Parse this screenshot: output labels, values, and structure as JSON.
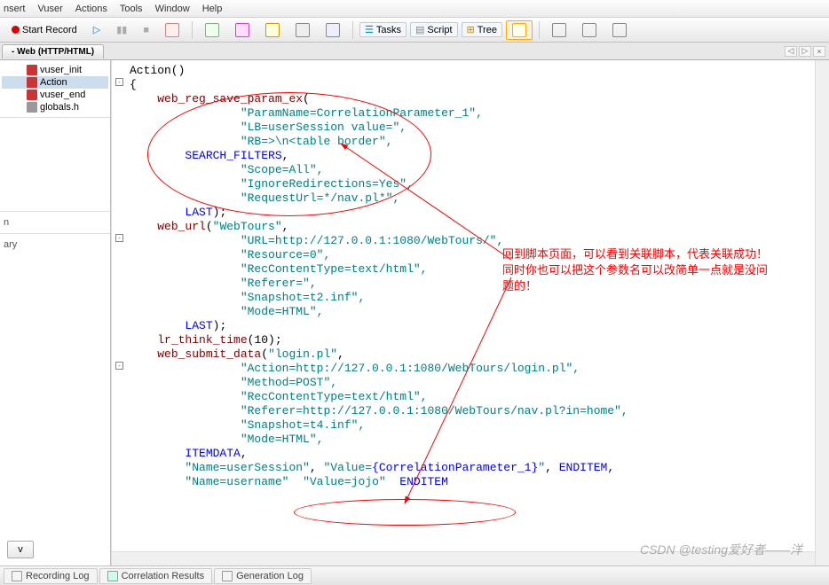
{
  "menu": {
    "insert": "nsert",
    "vuser": "Vuser",
    "actions": "Actions",
    "tools": "Tools",
    "window": "Window",
    "help": "Help"
  },
  "toolbar": {
    "startRecord": "Start Record",
    "tasks": "Tasks",
    "script": "Script",
    "tree": "Tree"
  },
  "scriptTab": {
    "title": "- Web (HTTP/HTML)"
  },
  "tree": {
    "vuser_init": "vuser_init",
    "action": "Action",
    "vuser_end": "vuser_end",
    "globals": "globals.h"
  },
  "side": {
    "n": "n",
    "ary": "ary",
    "btn": "v"
  },
  "code": {
    "l1": "Action()",
    "l2": "{",
    "l3": "    web_reg_save_param_ex(",
    "l4": "        \"ParamName=CorrelationParameter_1\",",
    "l5": "        \"LB=userSession value=\",",
    "l6": "        \"RB=>\\n<table border\",",
    "l7": "        SEARCH_FILTERS,",
    "l8": "        \"Scope=All\",",
    "l9": "        \"IgnoreRedirections=Yes\",",
    "l10": "        \"RequestUrl=*/nav.pl*\",",
    "l11": "        LAST);",
    "l12": "    web_url(\"WebTours\",",
    "l13": "        \"URL=http://127.0.0.1:1080/WebTours/\",",
    "l14": "        \"Resource=0\",",
    "l15": "        \"RecContentType=text/html\",",
    "l16": "        \"Referer=\",",
    "l17": "        \"Snapshot=t2.inf\",",
    "l18": "        \"Mode=HTML\",",
    "l19": "        LAST);",
    "l20": "    lr_think_time(10);",
    "l21": "    web_submit_data(\"login.pl\",",
    "l22": "        \"Action=http://127.0.0.1:1080/WebTours/login.pl\",",
    "l23": "        \"Method=POST\",",
    "l24": "        \"RecContentType=text/html\",",
    "l25": "        \"Referer=http://127.0.0.1:1080/WebTours/nav.pl?in=home\",",
    "l26": "        \"Snapshot=t4.inf\",",
    "l27": "        \"Mode=HTML\",",
    "l28": "        ITEMDATA,",
    "l29a": "        \"Name=userSession\", \"Value=",
    "l29b": "{CorrelationParameter_1}",
    "l29c": "\", ",
    "l29d": "ENDITEM",
    "l29e": ",",
    "l30a": "        \"Name=username\"  \"Value=jojo\"  ",
    "l30b": "ENDITEM"
  },
  "annotation": {
    "line1": "回到脚本页面，可以看到关联脚本，代表关联成功！",
    "line2": "同时你也可以把这个参数名可以改简单一点就是没问",
    "line3": "题的！"
  },
  "bottomTabs": {
    "recording": "Recording Log",
    "correlation": "Correlation Results",
    "generation": "Generation Log"
  },
  "watermark": "CSDN @testing爱好者——洋"
}
